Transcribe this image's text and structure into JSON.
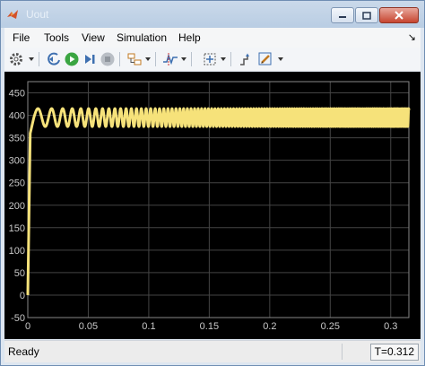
{
  "window": {
    "title": "Uout"
  },
  "menu": {
    "items": [
      "File",
      "Tools",
      "View",
      "Simulation",
      "Help"
    ]
  },
  "toolbar": {
    "icons": [
      "gear-icon",
      "step-back-icon",
      "run-icon",
      "step-forward-icon",
      "stop-icon",
      "highlight-simulink-block-icon",
      "triggers-icon",
      "zoom-icon",
      "autoscale-icon",
      "properties-icon"
    ]
  },
  "colors": {
    "signal": "#f6e27a",
    "plot_bg": "#000000",
    "grid": "#444444"
  },
  "status": {
    "text": "Ready",
    "time": "T=0.312"
  },
  "chart_data": {
    "type": "line",
    "title": "",
    "xlabel": "",
    "ylabel": "",
    "xlim": [
      0,
      0.315
    ],
    "ylim": [
      -50,
      475
    ],
    "grid": true,
    "x_ticks": [
      "0",
      "0.05",
      "0.1",
      "0.15",
      "0.2",
      "0.25",
      "0.3"
    ],
    "y_ticks": [
      "450",
      "400",
      "350",
      "300",
      "250",
      "200",
      "150",
      "100",
      "50",
      "0",
      "-50"
    ],
    "series": [
      {
        "name": "",
        "description_values": {
          "initial_rise": [
            [
              0,
              0
            ],
            [
              0.002,
              360
            ],
            [
              0.005,
              395
            ]
          ],
          "mean": 395,
          "amplitude": 20,
          "freq_start_hz": 70,
          "freq_end_hz": 700
        }
      }
    ]
  }
}
